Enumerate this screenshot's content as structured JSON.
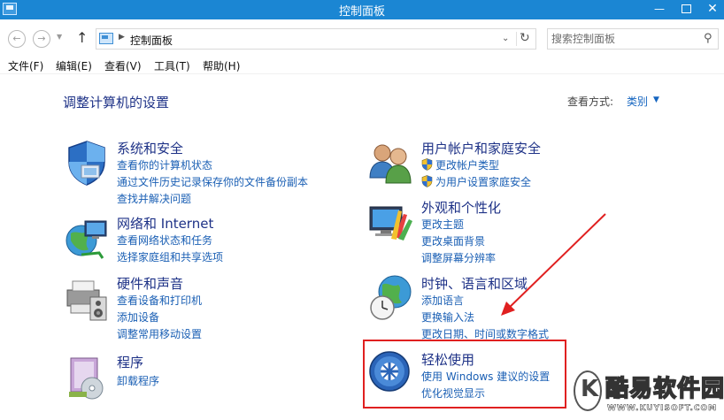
{
  "window": {
    "title": "控制面板",
    "minimize": "—",
    "close": "✕"
  },
  "nav": {
    "back": "←",
    "forward": "→",
    "up": "↑",
    "address": "控制面板",
    "search_placeholder": "搜索控制面板"
  },
  "menu": [
    "文件(F)",
    "编辑(E)",
    "查看(V)",
    "工具(T)",
    "帮助(H)"
  ],
  "page": {
    "title": "调整计算机的设置",
    "view_label": "查看方式:",
    "view_value": "类别"
  },
  "categories": [
    {
      "title": "系统和安全",
      "icon": "system-security-icon",
      "links": [
        "查看你的计算机状态",
        "通过文件历史记录保存你的文件备份副本",
        "查找并解决问题"
      ]
    },
    {
      "title": "网络和 Internet",
      "icon": "network-internet-icon",
      "links": [
        "查看网络状态和任务",
        "选择家庭组和共享选项"
      ]
    },
    {
      "title": "硬件和声音",
      "icon": "hardware-sound-icon",
      "links": [
        "查看设备和打印机",
        "添加设备",
        "调整常用移动设置"
      ]
    },
    {
      "title": "程序",
      "icon": "programs-icon",
      "links": [
        "卸载程序"
      ]
    },
    {
      "title": "用户帐户和家庭安全",
      "icon": "user-accounts-icon",
      "links": [
        "更改帐户类型",
        "为用户设置家庭安全"
      ]
    },
    {
      "title": "外观和个性化",
      "icon": "appearance-icon",
      "links": [
        "更改主题",
        "更改桌面背景",
        "调整屏幕分辨率"
      ]
    },
    {
      "title": "时钟、语言和区域",
      "icon": "clock-language-region-icon",
      "links": [
        "添加语言",
        "更换输入法",
        "更改日期、时间或数字格式"
      ]
    },
    {
      "title": "轻松使用",
      "icon": "ease-of-access-icon",
      "links": [
        "使用 Windows 建议的设置",
        "优化视觉显示"
      ]
    }
  ],
  "watermark": {
    "letter": "K",
    "text": "酷易软件园",
    "url": "WWW.KUYISOFT.COM"
  },
  "colors": {
    "titlebar": "#1b86d3",
    "heading": "#1e3287",
    "link": "#1a5fb4",
    "annotation": "#e02020"
  }
}
